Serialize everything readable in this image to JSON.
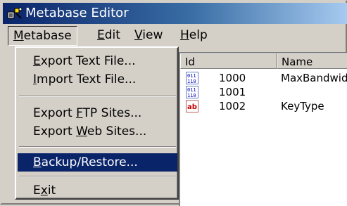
{
  "window": {
    "title": "Metabase Editor"
  },
  "menubar": {
    "metabase": {
      "pre": "",
      "mn": "M",
      "post": "etabase"
    },
    "edit": {
      "pre": "",
      "mn": "E",
      "post": "dit"
    },
    "view": {
      "pre": "",
      "mn": "V",
      "post": "iew"
    },
    "help": {
      "pre": "",
      "mn": "H",
      "post": "elp"
    }
  },
  "menu": {
    "export_text": {
      "pre": "",
      "mn": "E",
      "post": "xport Text File..."
    },
    "import_text": {
      "pre": "",
      "mn": "I",
      "post": "mport Text File..."
    },
    "export_ftp": {
      "pre": "Export ",
      "mn": "F",
      "post": "TP Sites..."
    },
    "export_web": {
      "pre": "Export ",
      "mn": "W",
      "post": "eb Sites..."
    },
    "backup": {
      "pre": "",
      "mn": "B",
      "post": "ackup/Restore..."
    },
    "exit": {
      "pre": "E",
      "mn": "x",
      "post": "it"
    }
  },
  "listview": {
    "columns": [
      "Id",
      "Name"
    ],
    "rows": [
      {
        "icon": "binary-value-icon",
        "id": "1000",
        "name": "MaxBandwid"
      },
      {
        "icon": "binary-value-icon",
        "id": "1001",
        "name": ""
      },
      {
        "icon": "string-value-icon",
        "id": "1002",
        "name": "KeyType"
      }
    ]
  },
  "colors": {
    "titlebar_start": "#0a246a",
    "titlebar_end": "#a6caf0",
    "selection": "#0a246a",
    "face": "#d4d0c8"
  }
}
